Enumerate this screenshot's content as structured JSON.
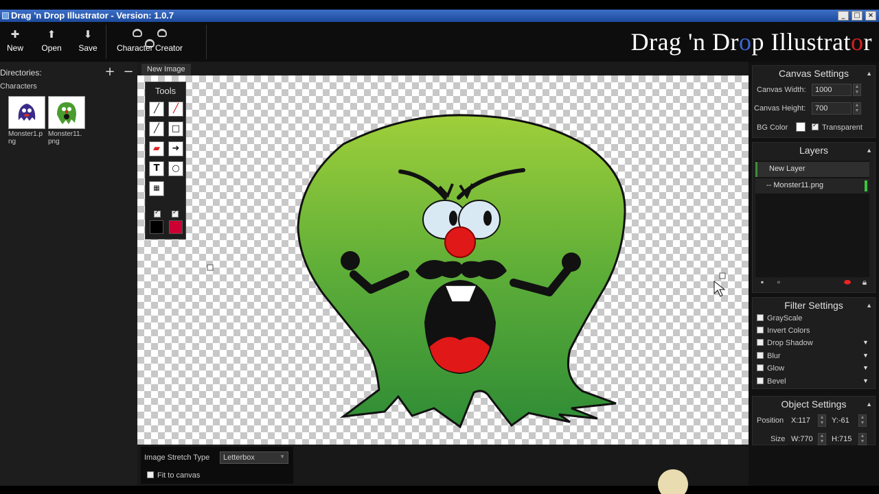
{
  "window": {
    "title": "Drag 'n Drop Illustrator - Version: 1.0.7"
  },
  "toolbar": {
    "new_label": "New",
    "open_label": "Open",
    "save_label": "Save",
    "character_creator_label": "Character Creator"
  },
  "brand": {
    "part1": "Drag 'n Dr",
    "o_letter": "o",
    "part2": "p Illustrat",
    "part3": "o",
    "part4": "r"
  },
  "left_panel": {
    "directories_label": "Directories:",
    "section_label": "Characters",
    "items": [
      {
        "name": "Monster1.png"
      },
      {
        "name": "Monster11.png"
      }
    ]
  },
  "tabs": {
    "new_image": "New Image"
  },
  "tools": {
    "title": "Tools",
    "icons": [
      "pencil-icon",
      "brush-icon",
      "line-icon",
      "rectangle-icon",
      "eraser-icon",
      "arrow-icon",
      "text-icon",
      "ellipse-icon",
      "checker-icon"
    ],
    "colors": {
      "stroke": "#000000",
      "fill": "#cc0033"
    }
  },
  "canvas_settings": {
    "title": "Canvas Settings",
    "width_label": "Canvas Width:",
    "width_value": "1000",
    "height_label": "Canvas Height:",
    "height_value": "700",
    "bg_color_label": "BG Color",
    "transparent_label": "Transparent"
  },
  "layers": {
    "title": "Layers",
    "items": [
      {
        "label": "New Layer"
      },
      {
        "label": "-- Monster11.png"
      }
    ]
  },
  "filters": {
    "title": "Filter Settings",
    "items": [
      {
        "label": "GrayScale"
      },
      {
        "label": "Invert Colors"
      },
      {
        "label": "Drop Shadow"
      },
      {
        "label": "Blur"
      },
      {
        "label": "Glow"
      },
      {
        "label": "Bevel"
      }
    ]
  },
  "object_settings": {
    "title": "Object Settings",
    "position_label": "Position",
    "x_value": "X:117",
    "y_value": "Y:-61",
    "size_label": "Size",
    "w_value": "W:770",
    "h_value": "H:715"
  },
  "bottom": {
    "stretch_label": "Image Stretch Type",
    "stretch_value": "Letterbox",
    "fit_label": "Fit to canvas"
  }
}
